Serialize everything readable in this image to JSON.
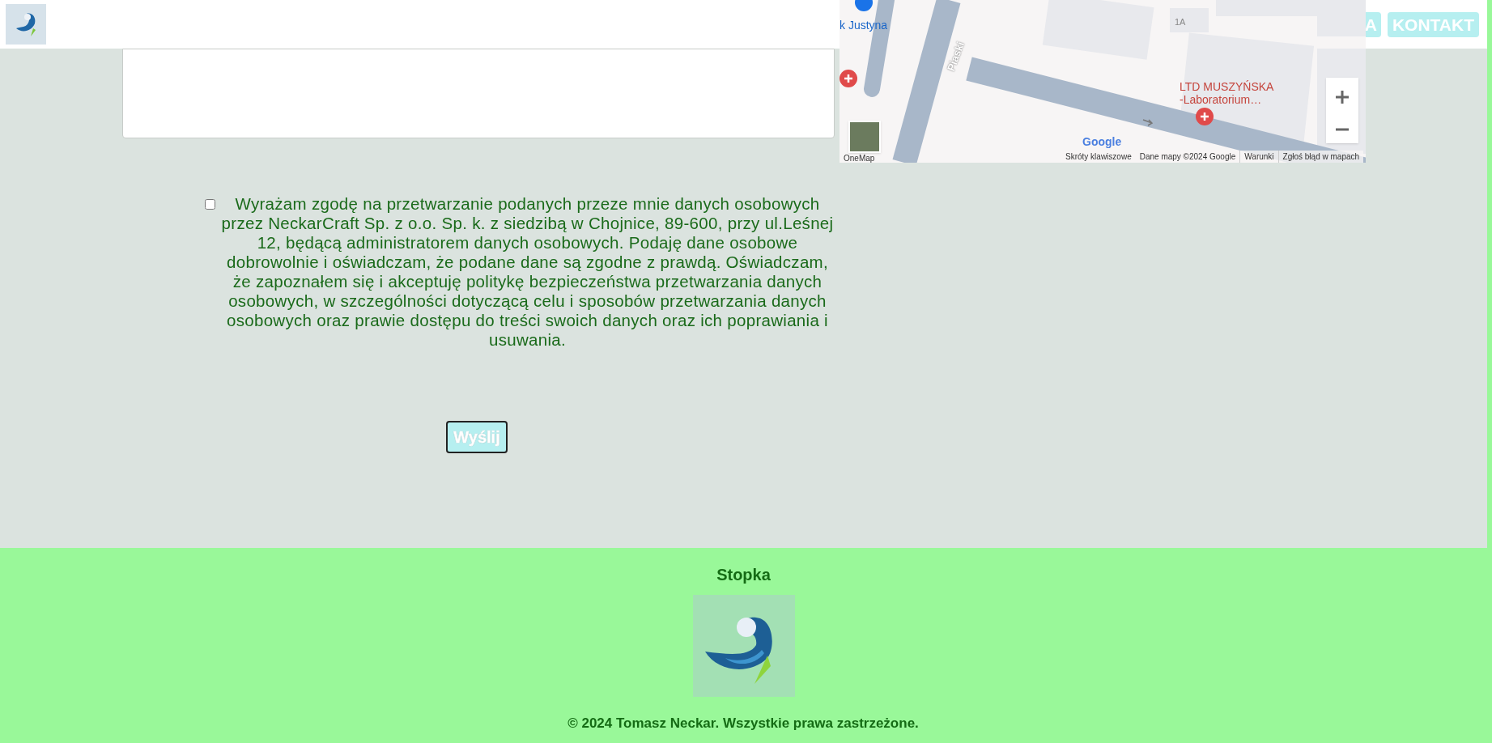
{
  "header": {
    "nav": [
      {
        "label": "A"
      },
      {
        "label": "KONTAKT"
      }
    ]
  },
  "map": {
    "poi": "k Justyna",
    "street": "Piaski",
    "building": "1A",
    "place": [
      "LTD MUSZYŃSKA",
      "-Laboratorium…"
    ],
    "logo": "Google",
    "layer_button": "OneMap",
    "links": [
      "Skróty klawiszowe",
      "Dane mapy ©2024 Google",
      "Warunki",
      "Zgłoś błąd w mapach"
    ]
  },
  "consent": {
    "checked": false,
    "text": "Wyrażam zgodę na przetwarzanie podanych przeze mnie danych osobowych przez NeckarCraft Sp. z o.o. Sp. k. z siedzibą w Chojnice, 89-600, przy ul.Leśnej 12, będącą administratorem danych osobowych. Podaję dane osobowe dobrowolnie i oświadczam, że podane dane są zgodne z prawdą. Oświadczam, że zapoznałem się i akceptuję politykę bezpieczeństwa przetwarzania danych osobowych, w szczególności dotyczącą celu i sposobów przetwarzania danych osobowych oraz prawie dostępu do treści swoich danych oraz ich poprawiania i usuwania."
  },
  "submit": {
    "label": "Wyślij"
  },
  "footer": {
    "title": "Stopka",
    "copyright": "© 2024 Tomasz Neckar. Wszystkie prawa zastrzeżone."
  }
}
